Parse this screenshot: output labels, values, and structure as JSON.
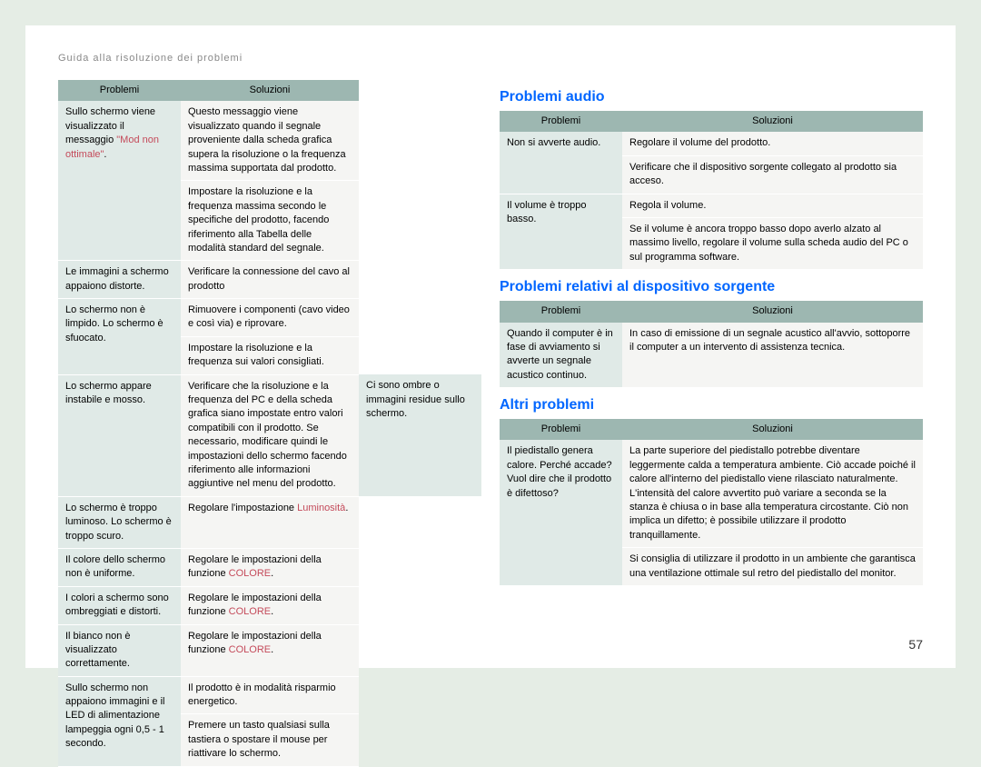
{
  "breadcrumb": "Guida alla risoluzione dei problemi",
  "pageNumber": "57",
  "colHeaders": {
    "problems": "Problemi",
    "solutions": "Soluzioni"
  },
  "sections": {
    "audio": {
      "title": "Problemi audio"
    },
    "source": {
      "title": "Problemi relativi al dispositivo sorgente"
    },
    "other": {
      "title": "Altri problemi"
    }
  },
  "left": [
    {
      "p": [
        {
          "t": "Sullo schermo viene visualizzato il messaggio "
        },
        {
          "t": "\"Mod non ottimale\"",
          "hl": true
        },
        {
          "t": "."
        }
      ],
      "pRows": 2,
      "s": [
        {
          "t": "Questo messaggio viene visualizzato quando il segnale proveniente dalla scheda grafica supera la risoluzione o la frequenza massima supportata dal prodotto."
        }
      ]
    },
    {
      "s": [
        {
          "t": "Impostare la risoluzione e la frequenza massima secondo le specifiche del prodotto, facendo riferimento alla Tabella delle modalità standard del segnale."
        }
      ]
    },
    {
      "p": [
        {
          "t": "Le immagini a schermo appaiono distorte."
        }
      ],
      "s": [
        {
          "t": "Verificare la connessione del cavo al prodotto"
        }
      ]
    },
    {
      "p": [
        {
          "t": "Lo schermo non è limpido. Lo schermo è sfuocato."
        }
      ],
      "pRows": 2,
      "s": [
        {
          "t": "Rimuovere i componenti (cavo video e così via) e riprovare."
        }
      ]
    },
    {
      "s": [
        {
          "t": "Impostare la risoluzione e la frequenza sui valori consigliati."
        }
      ]
    },
    {
      "p": [
        {
          "t": "Lo schermo appare instabile e mosso."
        }
      ],
      "pRows": 2,
      "s": [
        {
          "t": "Verificare che la risoluzione e la frequenza del PC e della scheda grafica siano impostate entro valori compatibili con il prodotto. Se necessario, modificare quindi le impostazioni dello schermo facendo riferimento alle informazioni aggiuntive nel menu del prodotto."
        }
      ],
      "sRows": 2
    },
    {
      "p": [
        {
          "t": "Ci sono ombre o immagini residue sullo schermo."
        }
      ]
    },
    {
      "p": [
        {
          "t": "Lo schermo è troppo luminoso. Lo schermo è troppo scuro."
        }
      ],
      "s": [
        {
          "t": "Regolare l'impostazione "
        },
        {
          "t": "Luminosità",
          "hl": true
        },
        {
          "t": "."
        }
      ]
    },
    {
      "p": [
        {
          "t": "Il colore dello schermo non è uniforme."
        }
      ],
      "s": [
        {
          "t": "Regolare le impostazioni della funzione "
        },
        {
          "t": "COLORE",
          "hl": true
        },
        {
          "t": "."
        }
      ]
    },
    {
      "p": [
        {
          "t": "I colori a schermo sono ombreggiati e distorti."
        }
      ],
      "s": [
        {
          "t": "Regolare le impostazioni della funzione "
        },
        {
          "t": "COLORE",
          "hl": true
        },
        {
          "t": "."
        }
      ]
    },
    {
      "p": [
        {
          "t": "Il bianco non è visualizzato correttamente."
        }
      ],
      "s": [
        {
          "t": "Regolare le impostazioni della funzione "
        },
        {
          "t": "COLORE",
          "hl": true
        },
        {
          "t": "."
        }
      ]
    },
    {
      "p": [
        {
          "t": "Sullo schermo non appaiono immagini e il LED di alimentazione lampeggia ogni 0,5 - 1 secondo."
        }
      ],
      "pRows": 2,
      "s": [
        {
          "t": "Il prodotto è in modalità risparmio energetico."
        }
      ]
    },
    {
      "s": [
        {
          "t": "Premere un tasto qualsiasi sulla tastiera o spostare il mouse per riattivare lo schermo."
        }
      ]
    }
  ],
  "audio": [
    {
      "p": [
        {
          "t": "Non si avverte audio."
        }
      ],
      "pRows": 2,
      "s": [
        {
          "t": "Regolare il volume del prodotto."
        }
      ]
    },
    {
      "s": [
        {
          "t": "Verificare che il dispositivo sorgente collegato al prodotto sia acceso."
        }
      ]
    },
    {
      "p": [
        {
          "t": "Il volume è troppo basso."
        }
      ],
      "pRows": 2,
      "s": [
        {
          "t": "Regola il volume."
        }
      ]
    },
    {
      "s": [
        {
          "t": "Se il volume è ancora troppo basso dopo averlo alzato al massimo livello, regolare il volume sulla scheda audio del PC o sul programma software."
        }
      ]
    }
  ],
  "source": [
    {
      "p": [
        {
          "t": "Quando il computer è in fase di avviamento si avverte un segnale acustico continuo."
        }
      ],
      "s": [
        {
          "t": "In caso di emissione di un segnale acustico all'avvio, sottoporre il computer a un intervento di assistenza tecnica."
        }
      ]
    }
  ],
  "other": [
    {
      "p": [
        {
          "t": "Il piedistallo genera calore. Perché accade? Vuol dire che il prodotto è difettoso?"
        }
      ],
      "pRows": 2,
      "s": [
        {
          "t": "La parte superiore del piedistallo potrebbe diventare leggermente calda a temperatura ambiente. Ciò accade poiché il calore all'interno del piedistallo viene rilasciato naturalmente. L'intensità del calore avvertito può variare a seconda se la stanza è chiusa o in base alla temperatura circostante. Ciò non implica un difetto; è possibile utilizzare il prodotto tranquillamente."
        }
      ]
    },
    {
      "s": [
        {
          "t": "Si consiglia di utilizzare il prodotto in un ambiente che garantisca una ventilazione ottimale sul retro del piedistallo del monitor."
        }
      ]
    }
  ]
}
